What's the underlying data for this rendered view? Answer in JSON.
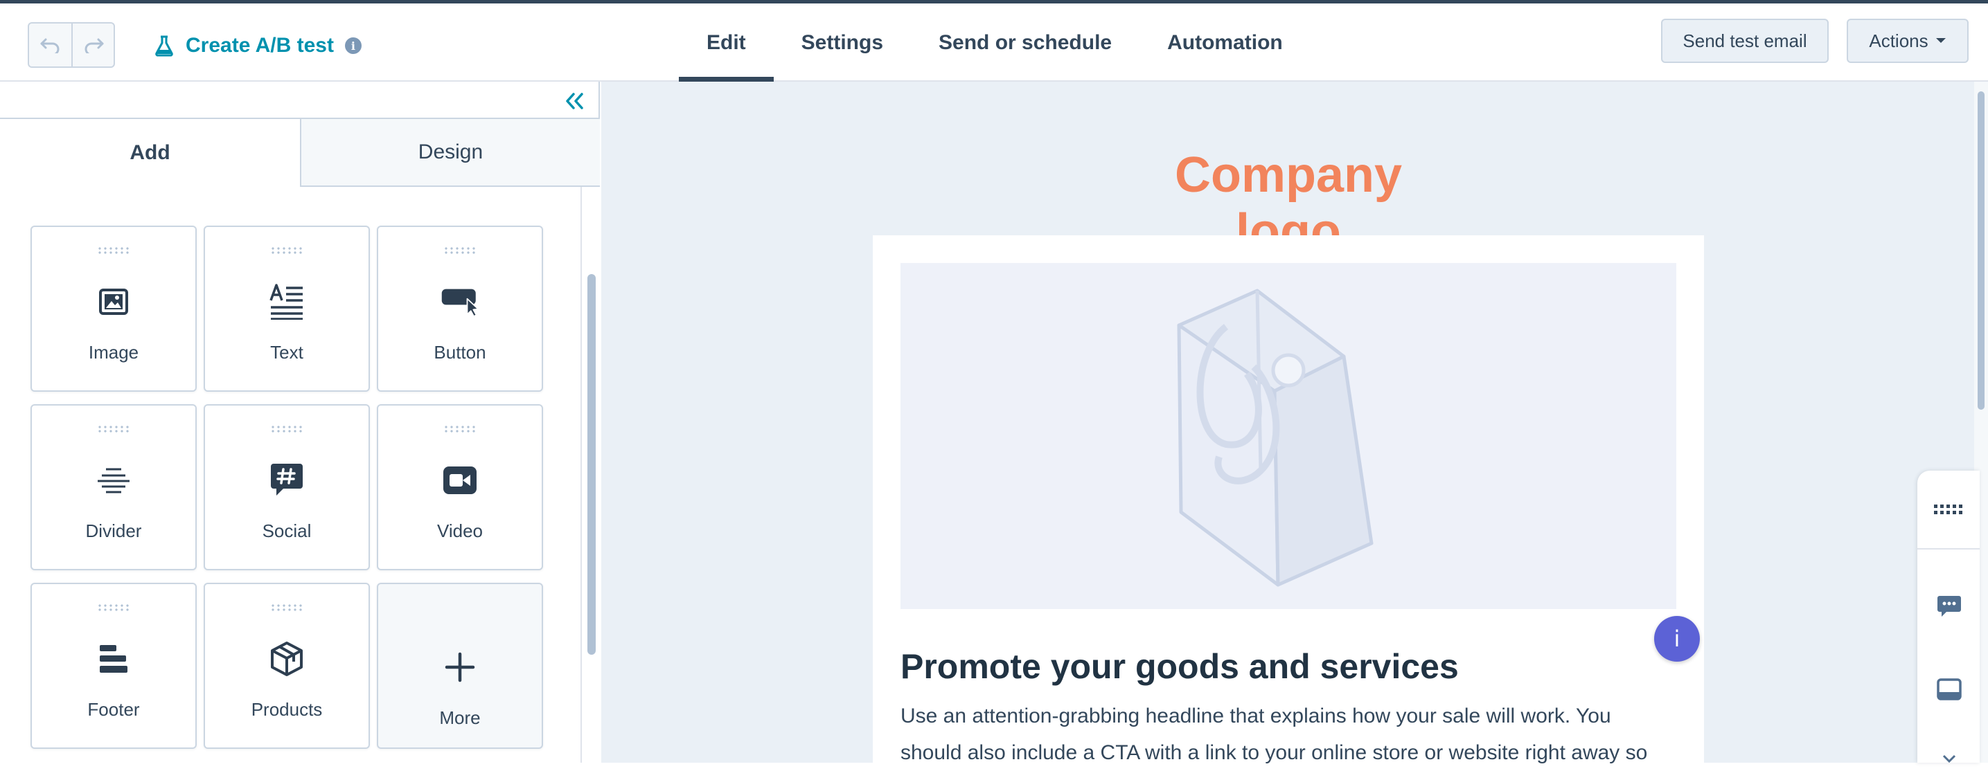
{
  "header": {
    "title": "Create A/B test",
    "tabs": [
      {
        "label": "Edit",
        "active": true
      },
      {
        "label": "Settings",
        "active": false
      },
      {
        "label": "Send or schedule",
        "active": false
      },
      {
        "label": "Automation",
        "active": false
      }
    ],
    "send_test_label": "Send test email",
    "actions_label": "Actions"
  },
  "left_panel": {
    "tabs": [
      {
        "label": "Add",
        "active": true
      },
      {
        "label": "Design",
        "active": false
      }
    ],
    "modules": [
      {
        "label": "Image",
        "icon": "image-icon"
      },
      {
        "label": "Text",
        "icon": "text-icon"
      },
      {
        "label": "Button",
        "icon": "button-icon"
      },
      {
        "label": "Divider",
        "icon": "divider-icon"
      },
      {
        "label": "Social",
        "icon": "social-icon"
      },
      {
        "label": "Video",
        "icon": "video-icon"
      },
      {
        "label": "Footer",
        "icon": "footer-icon"
      },
      {
        "label": "Products",
        "icon": "products-icon"
      },
      {
        "label": "More",
        "icon": "plus-icon"
      }
    ]
  },
  "email": {
    "logo_text": "Company logo",
    "headline": "Promote your goods and services",
    "body_line1": "Use an attention-grabbing headline that explains how your sale will work. You",
    "body_line2": "should also include a CTA with a link to your online store or website right away so",
    "info_badge": "i"
  },
  "colors": {
    "accent": "#0091ae",
    "dark": "#33475b",
    "logo": "#f2845c",
    "canvas_bg": "#eaf0f6",
    "badge": "#5c62d6"
  }
}
